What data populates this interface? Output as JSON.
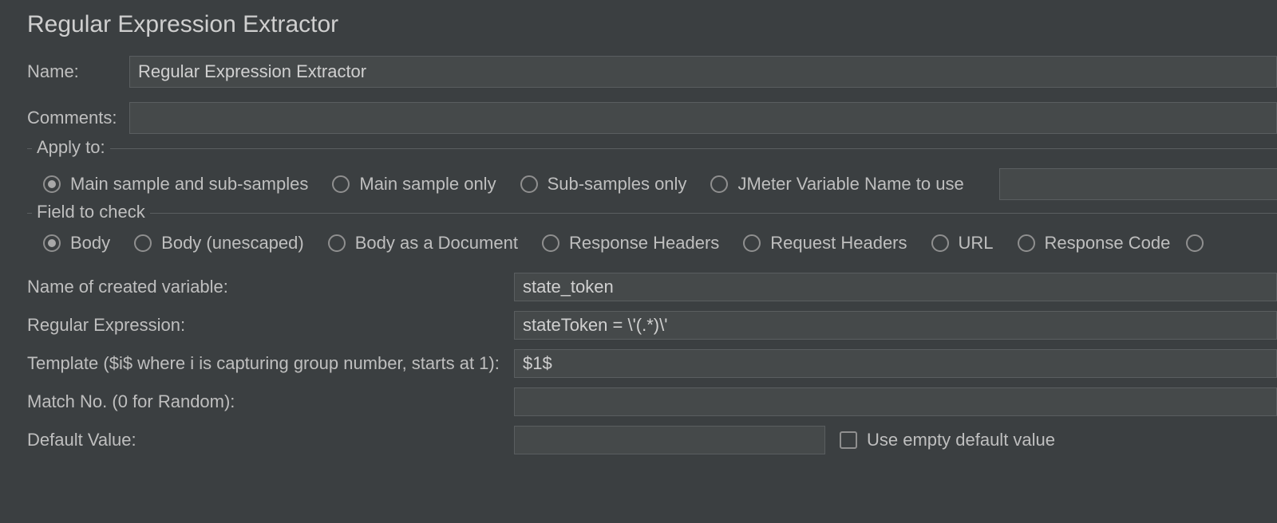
{
  "title": "Regular Expression Extractor",
  "name_label": "Name:",
  "name_value": "Regular Expression Extractor",
  "comments_label": "Comments:",
  "comments_value": "",
  "apply_to": {
    "legend": "Apply to:",
    "options": {
      "main_and_sub": "Main sample and sub-samples",
      "main_only": "Main sample only",
      "sub_only": "Sub-samples only",
      "jmeter_var": "JMeter Variable Name to use"
    },
    "selected": "main_and_sub",
    "jmeter_var_value": ""
  },
  "field_to_check": {
    "legend": "Field to check",
    "options": {
      "body": "Body",
      "body_unescaped": "Body (unescaped)",
      "body_document": "Body as a Document",
      "response_headers": "Response Headers",
      "request_headers": "Request Headers",
      "url": "URL",
      "response_code": "Response Code"
    },
    "selected": "body"
  },
  "fields": {
    "created_var_label": "Name of created variable:",
    "created_var_value": "state_token",
    "regex_label": "Regular Expression:",
    "regex_value": "stateToken = \\'(.*)\\'",
    "template_label": "Template ($i$ where i is capturing group number, starts at 1):",
    "template_value": "$1$",
    "match_no_label": "Match No. (0 for Random):",
    "match_no_value": "",
    "default_label": "Default Value:",
    "default_value": "",
    "use_empty_label": "Use empty default value",
    "use_empty_checked": false
  }
}
